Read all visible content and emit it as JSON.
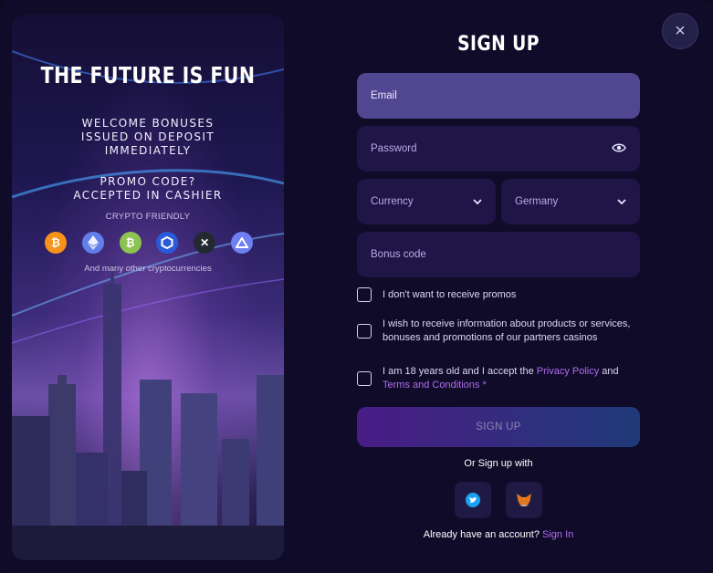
{
  "hero": {
    "title": "THE FUTURE IS FUN",
    "sub1": [
      "WELCOME BONUSES",
      "ISSUED ON DEPOSIT",
      "IMMEDIATELY"
    ],
    "sub2": [
      "PROMO CODE?",
      "ACCEPTED IN CASHIER"
    ],
    "crypto_label": "CRYPTO FRIENDLY",
    "coins": [
      "bitcoin-icon",
      "ethereum-icon",
      "bitcoin-cash-icon",
      "chainlink-icon",
      "xrp-icon",
      "aave-icon"
    ],
    "many": "And many other cryptocurrencies"
  },
  "form": {
    "title": "SIGN UP",
    "email_placeholder": "Email",
    "password_placeholder": "Password",
    "currency_placeholder": "Currency",
    "country_value": "Germany",
    "bonus_placeholder": "Bonus code",
    "check1": "I don't want to receive promos",
    "check2": "I wish to receive information about products or services, bonuses and promotions of our partners casinos",
    "check3_pre": "I am 18 years old and I accept the ",
    "check3_link1": "Privacy Policy",
    "check3_and": " and",
    "check3_link2": "Terms and Conditions",
    "check3_star": " *",
    "signup_label": "SIGN UP",
    "or_text": "Or Sign up with",
    "already_text": "Already have an account? ",
    "signin_link": "Sign In"
  },
  "colors": {
    "accent_link": "#b06cf0",
    "field_bg": "#1f1547",
    "active_field": "#514790"
  }
}
